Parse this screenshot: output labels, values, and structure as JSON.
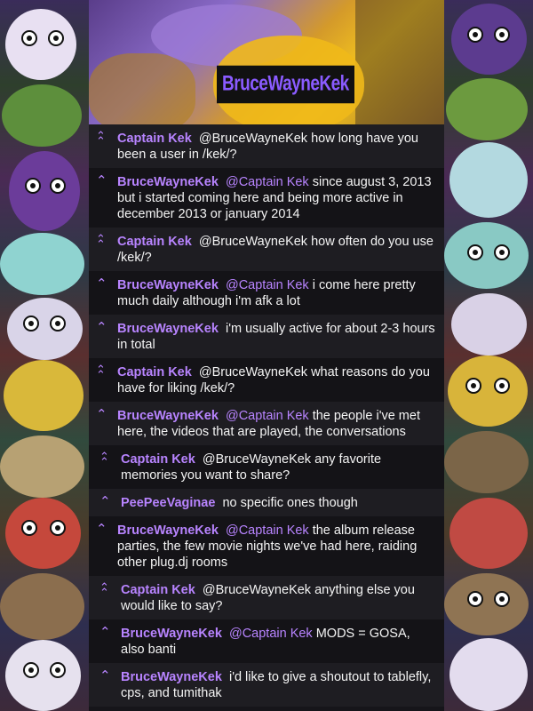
{
  "banner": {
    "username": "BruceWayneKek"
  },
  "messages": [
    {
      "sender": "Captain Kek",
      "mention": "",
      "text": "@BruceWayneKek how long have you been a user in /kek/?",
      "icon": "double-chevron-up-icon"
    },
    {
      "sender": "BruceWayneKek",
      "mention": "@Captain Kek",
      "text": "since august 3, 2013 but i started coming here and being more active in december 2013 or january 2014",
      "icon": "chevron-up-icon"
    },
    {
      "sender": "Captain Kek",
      "mention": "",
      "text": "@BruceWayneKek how often do you use /kek/?",
      "icon": "double-chevron-up-icon"
    },
    {
      "sender": "BruceWayneKek",
      "mention": "@Captain Kek",
      "text": "i come here pretty much daily although i'm afk a lot",
      "icon": "chevron-up-icon"
    },
    {
      "sender": "BruceWayneKek",
      "mention": "",
      "text": "i'm usually active for about 2-3 hours in total",
      "icon": "chevron-up-icon"
    },
    {
      "sender": "Captain Kek",
      "mention": "",
      "text": "@BruceWayneKek what reasons do you have for liking /kek/?",
      "icon": "double-chevron-up-icon"
    },
    {
      "sender": "BruceWayneKek",
      "mention": "@Captain Kek",
      "text": "the people i've met here, the videos that are played, the conversations",
      "icon": "chevron-up-icon"
    },
    {
      "sender": "Captain Kek",
      "mention": "",
      "text": "@BruceWayneKek any favorite memories you want to share?",
      "icon": "double-chevron-up-icon"
    },
    {
      "sender": "PeePeeVaginae",
      "mention": "",
      "text": "no specific ones though",
      "icon": "chevron-up-icon"
    },
    {
      "sender": "BruceWayneKek",
      "mention": "@Captain Kek",
      "text": "the album release parties, the few movie nights we've had here, raiding other plug.dj rooms",
      "icon": "chevron-up-icon"
    },
    {
      "sender": "Captain Kek",
      "mention": "",
      "text": "@BruceWayneKek anything else you would like to say?",
      "icon": "double-chevron-up-icon"
    },
    {
      "sender": "BruceWayneKek",
      "mention": "@Captain Kek",
      "text": "MODS = GOSA, also banti",
      "icon": "chevron-up-icon"
    },
    {
      "sender": "BruceWayneKek",
      "mention": "",
      "text": "i'd like to give a shoutout to tablefly, cps, and tumithak",
      "icon": "chevron-up-icon"
    }
  ]
}
